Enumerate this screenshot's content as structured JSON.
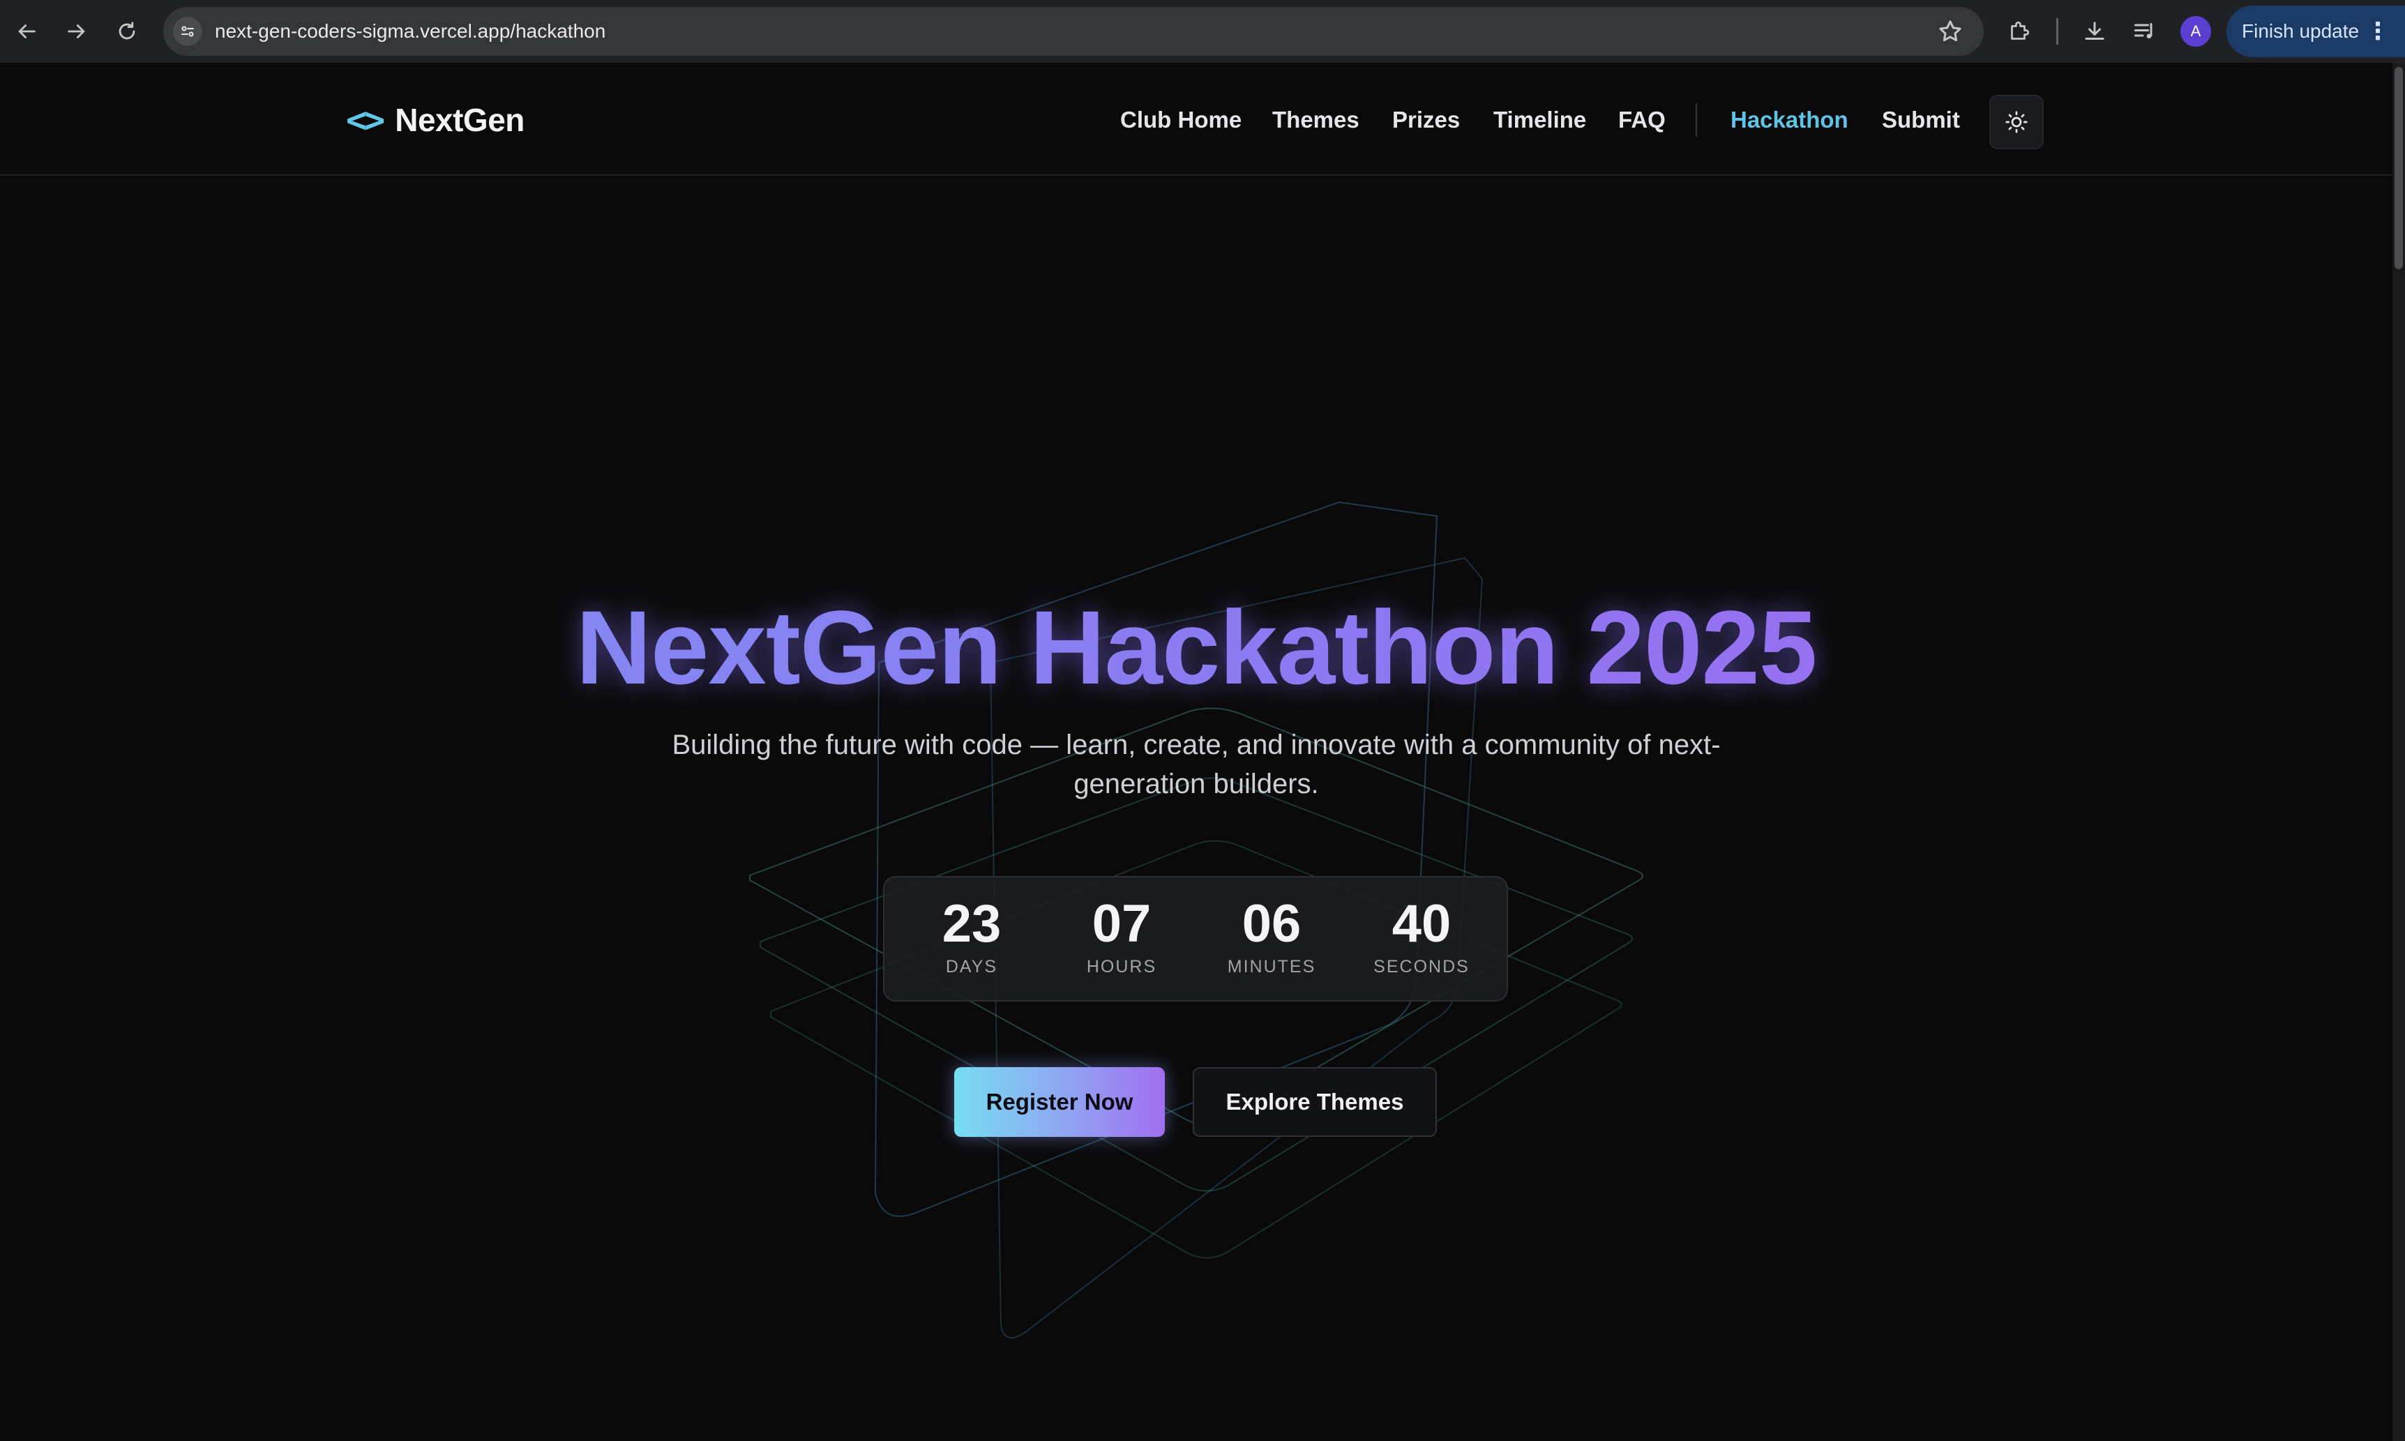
{
  "browser": {
    "url": "next-gen-coders-sigma.vercel.app/hackathon",
    "avatar_initial": "A",
    "finish_update_label": "Finish update",
    "menu_glyph": "⋮"
  },
  "site": {
    "logo_brackets": "<>",
    "logo_text": "NextGen",
    "nav": [
      {
        "label": "Club Home"
      },
      {
        "label": "Themes"
      },
      {
        "label": "Prizes"
      },
      {
        "label": "Timeline"
      },
      {
        "label": "FAQ"
      },
      {
        "label": "Hackathon"
      },
      {
        "label": "Submit"
      }
    ],
    "active_nav": "Hackathon",
    "accent_color": "#5ec3e6",
    "theme_toggle_icon": "sun-icon"
  },
  "hero": {
    "title": "NextGen Hackathon 2025",
    "subtitle": "Building the future with code — learn, create, and innovate with a community of next-generation builders.",
    "countdown": [
      {
        "value": "23",
        "label": "DAYS"
      },
      {
        "value": "07",
        "label": "HOURS"
      },
      {
        "value": "06",
        "label": "MINUTES"
      },
      {
        "value": "40",
        "label": "SECONDS"
      }
    ],
    "register_label": "Register Now",
    "explore_label": "Explore Themes",
    "gradient_colors": [
      "#76def2",
      "#8fa8f2",
      "#a06ff0"
    ]
  }
}
